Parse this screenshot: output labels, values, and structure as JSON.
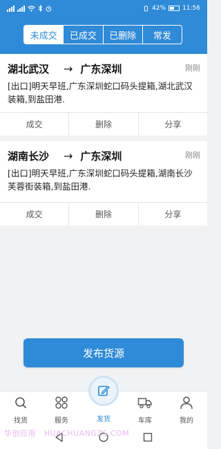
{
  "status_bar": {
    "battery": "42%",
    "time": "11:56"
  },
  "tabs": [
    {
      "label": "未成交",
      "active": true
    },
    {
      "label": "已成交",
      "active": false
    },
    {
      "label": "已删除",
      "active": false
    },
    {
      "label": "常发",
      "active": false
    }
  ],
  "cards": [
    {
      "from": "湖北武汉",
      "arrow": "→",
      "to": "广东深圳",
      "time": "刚刚",
      "desc": "[出口]明天早班,广东深圳蛇口码头提箱,湖北武汉装箱,到盐田港.",
      "actions": [
        "成交",
        "删除",
        "分享"
      ]
    },
    {
      "from": "湖南长沙",
      "arrow": "→",
      "to": "广东深圳",
      "time": "刚刚",
      "desc": "[出口]明天早班,广东深圳蛇口码头提箱,湖南长沙芙蓉街装箱,到盐田港.",
      "actions": [
        "成交",
        "删除",
        "分享"
      ]
    }
  ],
  "publish_button": "发布货源",
  "bottom_nav": [
    {
      "label": "找货",
      "icon": "search-icon"
    },
    {
      "label": "服务",
      "icon": "grid-icon"
    },
    {
      "label": "发货",
      "icon": "edit-icon",
      "active": true
    },
    {
      "label": "车库",
      "icon": "truck-icon"
    },
    {
      "label": "我的",
      "icon": "person-icon"
    }
  ],
  "watermark": "华创应用 · HUACHUANGZS.COM",
  "colors": {
    "primary": "#2f8ad7",
    "background": "#f1f2f4"
  }
}
